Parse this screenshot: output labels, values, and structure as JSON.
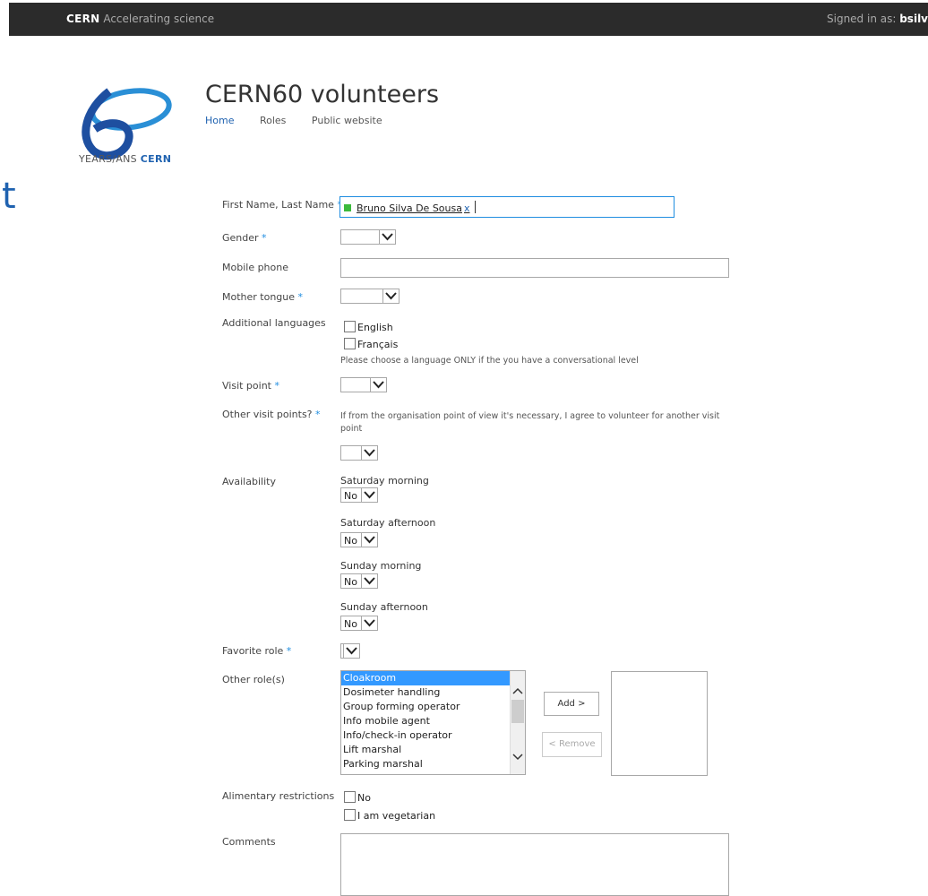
{
  "topbar": {
    "brand": "CERN",
    "tagline": "Accelerating science",
    "signed_in_label": "Signed in as:",
    "user": "bsilv"
  },
  "logo": {
    "years_text": "YEARS/ANS",
    "cern_text": "CERN"
  },
  "site": {
    "title": "CERN60 volunteers",
    "nav": [
      "Home",
      "Roles",
      "Public website"
    ]
  },
  "edge_text": "t",
  "form": {
    "name_label": "First Name, Last Name",
    "name_value": "Bruno Silva De Sousa",
    "name_remove": "x",
    "gender_label": "Gender",
    "mobile_label": "Mobile phone",
    "mother_tongue_label": "Mother tongue",
    "additional_languages_label": "Additional languages",
    "languages": [
      "English",
      "Français"
    ],
    "language_note": "Please choose a language ONLY if the you have a conversational  level",
    "visit_point_label": "Visit point",
    "other_visit_label": "Other visit points?",
    "other_visit_note": "If from the organisation point of view it's necessary, I agree to volunteer for another visit point",
    "availability_label": "Availability",
    "availability": [
      {
        "label": "Saturday morning",
        "value": "No"
      },
      {
        "label": "Saturday afternoon",
        "value": "No"
      },
      {
        "label": "Sunday morning",
        "value": "No"
      },
      {
        "label": "Sunday afternoon",
        "value": "No"
      }
    ],
    "favorite_role_label": "Favorite role",
    "other_roles_label": "Other role(s)",
    "roles": [
      "Cloakroom",
      "Dosimeter handling",
      "Group forming operator",
      "Info mobile agent",
      "Info/check-in operator",
      "Lift marshal",
      "Parking marshal"
    ],
    "add_label": "Add >",
    "remove_label": "< Remove",
    "alimentary_label": "Alimentary restrictions",
    "alimentary_options": [
      "No",
      "I am vegetarian"
    ],
    "comments_label": "Comments",
    "required_mark": "*"
  },
  "colors": {
    "accent": "#1f62b0",
    "required": "#1f8de0",
    "selected": "#3399ff",
    "topbar": "#2b2b2b"
  }
}
